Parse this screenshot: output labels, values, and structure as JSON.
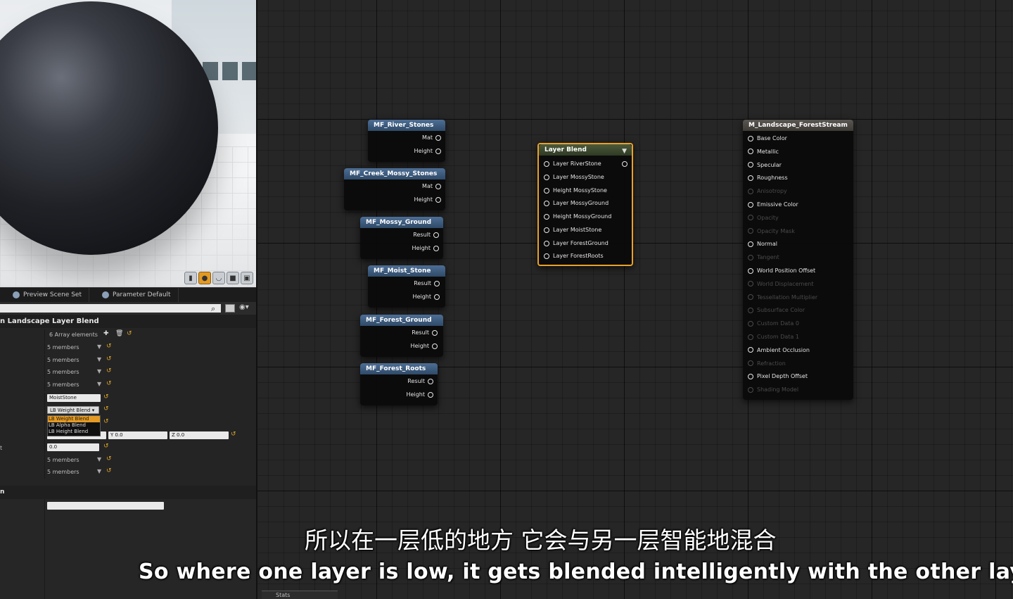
{
  "preview_tabs": [
    {
      "label": "Preview Scene Set"
    },
    {
      "label": "Parameter Default"
    }
  ],
  "details": {
    "category_title": "n Landscape Layer Blend",
    "array_label": "6 Array elements",
    "rows": [
      {
        "value": "5 members"
      },
      {
        "value": "5 members"
      },
      {
        "value": "5 members"
      },
      {
        "value": "5 members"
      }
    ],
    "layer_name_field": "MoistStone",
    "blend_type_selected": "LB Weight Blend",
    "blend_type_options": [
      "LB Weight Blend",
      "LB Alpha Blend",
      "LB Height Blend"
    ],
    "vector_y": "Y  0.0",
    "vector_z": "Z  0.0",
    "scalar_label": "t",
    "scalar_value": "0.0",
    "rows_bottom": [
      {
        "value": "5 members"
      },
      {
        "value": "5 members"
      }
    ],
    "category2_title": "n"
  },
  "nodes": {
    "river_stones": {
      "title": "MF_River_Stones",
      "pins": [
        "Mat",
        "Height"
      ]
    },
    "creek_mossy_stones": {
      "title": "MF_Creek_Mossy_Stones",
      "pins": [
        "Mat",
        "Height"
      ]
    },
    "mossy_ground": {
      "title": "MF_Mossy_Ground",
      "pins": [
        "Result",
        "Height"
      ]
    },
    "moist_stone": {
      "title": "MF_Moist_Stone",
      "pins": [
        "Result",
        "Height"
      ]
    },
    "forest_ground": {
      "title": "MF_Forest_Ground",
      "pins": [
        "Result",
        "Height"
      ]
    },
    "forest_roots": {
      "title": "MF_Forest_Roots",
      "pins": [
        "Result",
        "Height"
      ]
    },
    "layer_blend": {
      "title": "Layer Blend",
      "pins": [
        "Layer RiverStone",
        "Layer MossyStone",
        "Height MossyStone",
        "Layer MossyGround",
        "Height MossyGround",
        "Layer MoistStone",
        "Layer ForestGround",
        "Layer ForestRoots"
      ]
    },
    "output": {
      "title": "M_Landscape_ForestStream",
      "pins": [
        {
          "label": "Base Color",
          "enabled": true
        },
        {
          "label": "Metallic",
          "enabled": true
        },
        {
          "label": "Specular",
          "enabled": true
        },
        {
          "label": "Roughness",
          "enabled": true
        },
        {
          "label": "Anisotropy",
          "enabled": false
        },
        {
          "label": "Emissive Color",
          "enabled": true
        },
        {
          "label": "Opacity",
          "enabled": false
        },
        {
          "label": "Opacity Mask",
          "enabled": false
        },
        {
          "label": "Normal",
          "enabled": true
        },
        {
          "label": "Tangent",
          "enabled": false
        },
        {
          "label": "World Position Offset",
          "enabled": true
        },
        {
          "label": "World Displacement",
          "enabled": false
        },
        {
          "label": "Tessellation Multiplier",
          "enabled": false
        },
        {
          "label": "Subsurface Color",
          "enabled": false
        },
        {
          "label": "Custom Data 0",
          "enabled": false
        },
        {
          "label": "Custom Data 1",
          "enabled": false
        },
        {
          "label": "Ambient Occlusion",
          "enabled": true
        },
        {
          "label": "Refraction",
          "enabled": false
        },
        {
          "label": "Pixel Depth Offset",
          "enabled": true
        },
        {
          "label": "Shading Model",
          "enabled": false
        }
      ]
    }
  },
  "stats_tab": "Stats",
  "subtitles": {
    "chinese": "所以在一层低的地方 它会与另一层智能地混合",
    "english": "So where one layer is low, it gets blended intelligently with the other layer."
  },
  "colors": {
    "accent_orange": "#e8a12b",
    "node_header_blue": "#3d5a7e"
  }
}
